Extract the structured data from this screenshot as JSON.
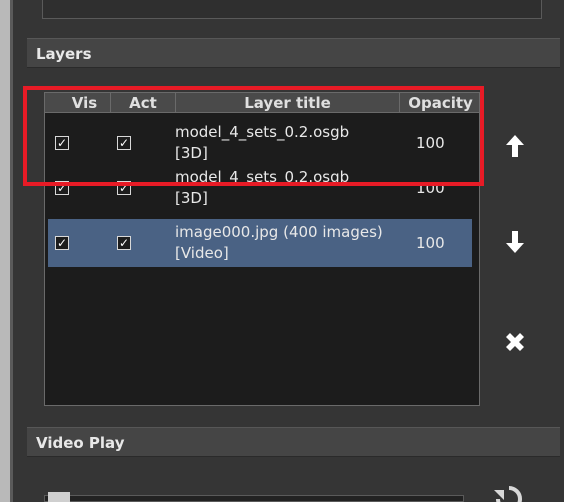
{
  "layers_section": {
    "title": "Layers"
  },
  "video_section": {
    "title": "Video Play"
  },
  "table": {
    "columns": {
      "vis": "Vis",
      "act": "Act",
      "title": "Layer title",
      "opacity": "Opacity"
    },
    "rows": [
      {
        "title": "model_4_sets_0.2.osgb [3D]",
        "opacity": "100",
        "vis": true,
        "act": true
      },
      {
        "title": "model_4_sets_0.2.osgb [3D]",
        "opacity": "100",
        "vis": true,
        "act": true
      },
      {
        "title": "image000.jpg (400 images) [Video]",
        "opacity": "100",
        "vis": true,
        "act": true,
        "selected": true
      }
    ]
  },
  "icons": {
    "move_up": "arrow-up-icon",
    "move_down": "arrow-down-icon",
    "remove": "close-icon",
    "replay": "replay-icon"
  },
  "colors": {
    "selected_row": "#4a6284",
    "highlight": "#e81b26"
  }
}
